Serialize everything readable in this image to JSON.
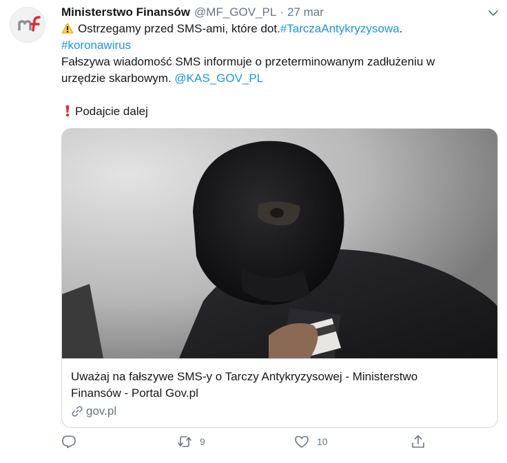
{
  "tweet": {
    "author_name": "Ministerstwo Finansów",
    "author_handle": "@MF_GOV_PL",
    "separator": "·",
    "timestamp": "27 mar",
    "avatar_icon": "mf-logo-icon",
    "line1_text": "Ostrzegamy przed SMS-ami, które dot.",
    "hashtag1": "#TarczaAntykryzysowa",
    "line1_end": ".",
    "hashtag2": "#koronawirus",
    "line3_text": "Fałszywa wiadomość SMS informuje o przeterminowanym zadłużeniu w",
    "line4_text": "urzędzie skarbowym.",
    "mention": "@KAS_GOV_PL",
    "line6_text": "Podajcie dalej"
  },
  "card": {
    "image_icon": "masked-thief-with-card-photo",
    "title_line1": "Uważaj na fałszywe SMS-y o Tarczy Antykryzysowej - Ministerstwo",
    "title_line2": "Finansów - Portal Gov.pl",
    "domain": "gov.pl"
  },
  "actions": {
    "reply_icon": "reply-icon",
    "retweet_icon": "retweet-icon",
    "retweet_count": "9",
    "like_icon": "heart-icon",
    "like_count": "10",
    "share_icon": "share-icon"
  },
  "colors": {
    "link": "#1b95e0",
    "muted": "#657786",
    "text": "#14171a",
    "brand_red": "#e0262b",
    "brand_gray": "#8a8f99"
  }
}
